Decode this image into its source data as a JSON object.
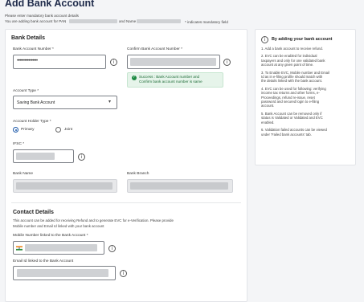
{
  "page": {
    "title": "Add Bank Account",
    "mandatory_note": "Please enter mandatory bank account details",
    "adding_prefix": "You are adding bank account for PAN",
    "and_name": "and Name",
    "required_note": "* indicates mandatory field"
  },
  "bank_details": {
    "heading": "Bank Details",
    "account_number_label": "Bank Account Number *",
    "account_number_value": "••••••••••••••••",
    "confirm_label": "Confirm Bank Account Number *",
    "success_line1": "Success : Bank Account number and",
    "success_line2": "Confirm bank account number is same",
    "account_type_label": "Account Type *",
    "account_type_value": "Saving Bank Account",
    "holder_type_label": "Account Holder Type *",
    "holder_primary": "Primary",
    "holder_joint": "Joint",
    "ifsc_label": "IFSC *",
    "bank_name_label": "Bank Name",
    "bank_branch_label": "Bank Branch"
  },
  "contact": {
    "heading": "Contact Details",
    "desc_line1": "This account can be added for receiving Refund and to generate EVC for e-Verification. Please provide",
    "desc_line2": "Mobile number and Email Id linked with your bank account",
    "mobile_label": "Mobile Number linked to the Bank Account *",
    "email_label": "Email Id linked to the Bank Account"
  },
  "sidebar": {
    "title": "By adding your bank account",
    "items": [
      [
        "1. Add a bank account to receive refund."
      ],
      [
        "2. EVC can be enabled for individual",
        "taxpayers and only for one validated bank",
        "account at any given point of time."
      ],
      [
        "3. To Enable EVC, Mobile number and Email",
        "Id as in e-filing profile should match with",
        "the details linked with the bank account."
      ],
      [
        "4. EVC can be used for following: verifying",
        "income tax returns and other forms, e-",
        "Proceedings, refund re-issue, reset",
        "password and secured login to e-filing",
        "account."
      ],
      [
        "5. Bank Account can be removed only if",
        "status is Validated or Validated and EVC",
        "enabled."
      ],
      [
        "6. Validation failed accounts can be viewed",
        "under 'Failed bank accounts' tab."
      ]
    ]
  },
  "colors": {
    "accent": "#1a57a8",
    "success": "#1d8a42",
    "title": "#1e2a4a"
  }
}
